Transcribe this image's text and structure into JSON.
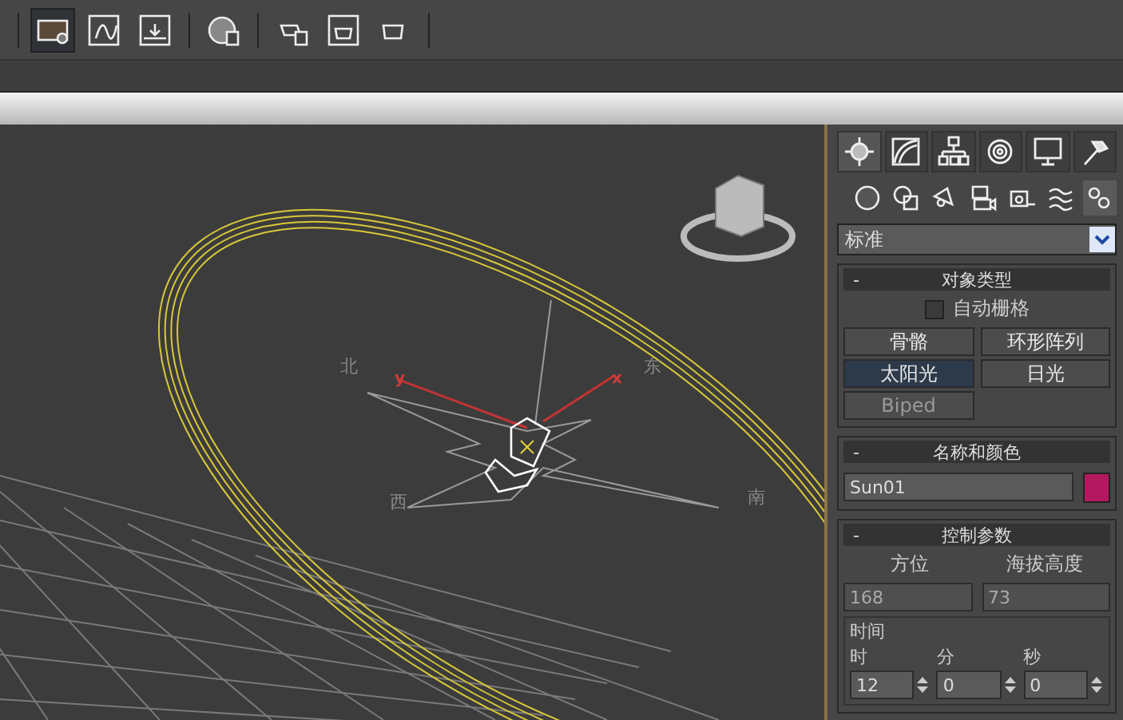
{
  "toolbar": {
    "buttons": [
      {
        "selected": true
      },
      {
        "selected": false
      },
      {
        "selected": false
      },
      {
        "selected": false
      },
      {
        "selected": false
      },
      {
        "selected": false
      },
      {
        "selected": false
      }
    ]
  },
  "viewport": {
    "compass": [
      "北",
      "东",
      "西",
      "南"
    ],
    "axes": [
      "y",
      "x"
    ]
  },
  "command_panel": {
    "tabs": [
      {
        "selected": true
      },
      {
        "selected": false
      },
      {
        "selected": false
      },
      {
        "selected": false
      },
      {
        "selected": false
      },
      {
        "selected": false
      }
    ],
    "categories": [
      {
        "selected": false
      },
      {
        "selected": false
      },
      {
        "selected": false
      },
      {
        "selected": false
      },
      {
        "selected": false
      },
      {
        "selected": false
      },
      {
        "selected": true
      }
    ],
    "dropdown": {
      "value": "标准"
    },
    "object_type": {
      "title": "对象类型",
      "collapse": "-",
      "autogrid": {
        "label": "自动栅格",
        "checked": false
      },
      "buttons": [
        {
          "label": "骨骼",
          "selected": false,
          "disabled": false
        },
        {
          "label": "环形阵列",
          "selected": false,
          "disabled": false
        },
        {
          "label": "太阳光",
          "selected": true,
          "disabled": false
        },
        {
          "label": "日光",
          "selected": false,
          "disabled": false
        },
        {
          "label": "Biped",
          "selected": false,
          "disabled": true
        }
      ]
    },
    "name_color": {
      "title": "名称和颜色",
      "collapse": "-",
      "name": "Sun01",
      "color": "#b4195f"
    },
    "control": {
      "title": "控制参数",
      "collapse": "-",
      "azimuth": {
        "label": "方位",
        "value": "168"
      },
      "altitude": {
        "label": "海拔高度",
        "value": "73"
      },
      "time": {
        "title": "时间",
        "spinners": [
          {
            "label": "时",
            "value": "12"
          },
          {
            "label": "分",
            "value": "0"
          },
          {
            "label": "秒",
            "value": "0"
          }
        ]
      }
    }
  }
}
